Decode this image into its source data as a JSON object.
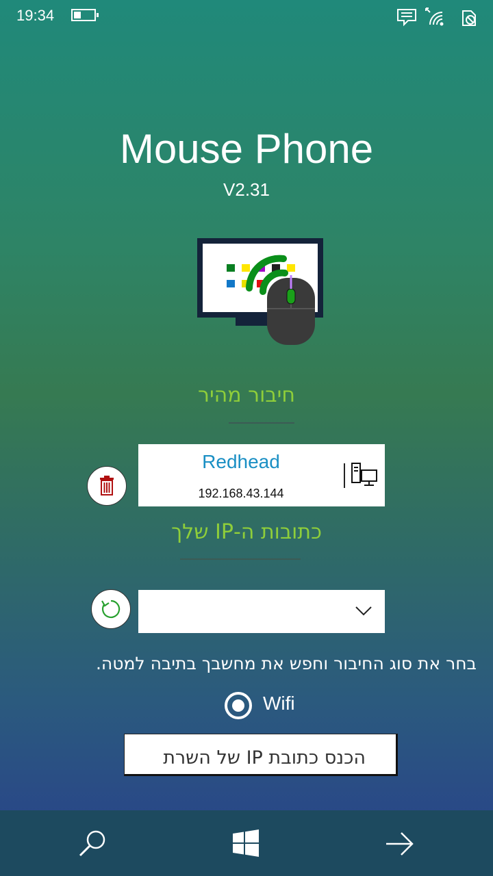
{
  "status_bar": {
    "time": "19:34",
    "battery_level": 0.35,
    "icons": [
      "message-icon",
      "wifi-signal-icon",
      "battery-saver-icon"
    ]
  },
  "app": {
    "title": "Mouse Phone",
    "version": "V2.31",
    "logo": "monitor-mouse-wifi-logo"
  },
  "quick_connect": {
    "title": "חיבור מהיר",
    "device_name": "Redhead",
    "device_ip": "192.168.43.144",
    "delete_icon": "trash-icon",
    "device_icon": "computer-network-icon"
  },
  "my_ip": {
    "title": "כתובות ה-IP שלך",
    "selected": "",
    "refresh_icon": "refresh-icon"
  },
  "instruction": "בחר את סוג החיבור וחפש את מחשבך בתיבה למטה.",
  "connection_type": {
    "label": "Wifi",
    "selected": true
  },
  "server_ip": {
    "placeholder": "הכנס כתובת IP של השרת",
    "value": ""
  },
  "nav": {
    "icons": [
      "search-icon",
      "windows-icon",
      "forward-arrow-icon"
    ]
  },
  "colors": {
    "accent_green": "#8fce3a",
    "device_name_blue": "#1a8fc4",
    "delete_red": "#b01010",
    "refresh_green": "#27a02e",
    "nav_bar": "#1d4a5f"
  }
}
